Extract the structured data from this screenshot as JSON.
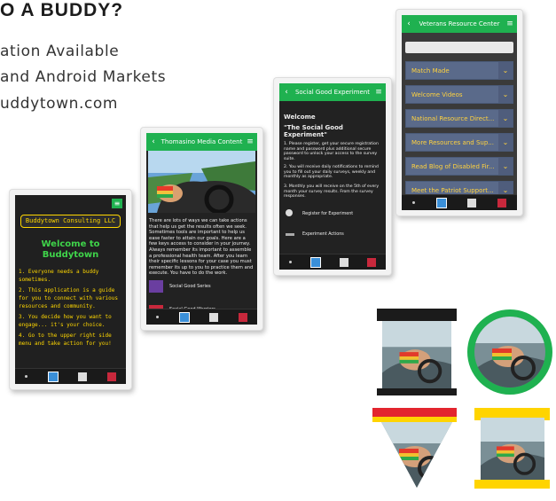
{
  "header": {
    "headline": "O A BUDDY?",
    "lines": [
      "ation Available",
      "and Android Markets",
      "uddytown.com"
    ]
  },
  "phone1": {
    "logo": "Buddytown Consulting LLC",
    "welcome": "Welcome to Buddytown",
    "items": [
      "1. Everyone needs a buddy sometimes.",
      "2. This application is a guide for you to connect with various resources and community.",
      "3. You decide how you want to engage... it's your choice.",
      "4. Go to the upper right side menu and take action for you!"
    ]
  },
  "phone2": {
    "title": "Thomasino Media Content",
    "body": "There are lots of ways we can take actions that help us get the results often we seek. Sometimes tools are important to help us ease faster to attain our goals. Here are a few keys access to consider in your journey. Always remember its important to assemble a professional health team. After you learn their specific lessons for your case you must remember its up to you to practice them and execute. You have to do the work.",
    "list": [
      "Social Good Series",
      "Social Good Warriors"
    ]
  },
  "phone3": {
    "title": "Social Good Experiment",
    "heading": "Welcome",
    "subheading": "\"The Social Good Experiment\"",
    "p1": "1. Please register, get your secure registration name and password plus additional secure password to unlock your access to the survey suite.",
    "p2": "2. You will receive daily notifications to remind you to fill out your daily surveys, weekly and monthly as appropriate.",
    "p3": "3. Monthly you will receive on the 5th of every month your survey results. From the survey responses.",
    "actions": [
      "Register for Experiment",
      "Experiment Actions"
    ]
  },
  "phone4": {
    "title": "Veterans Resource Center",
    "items": [
      "Match Made",
      "Welcome Videos",
      "National Resource Direct...",
      "More Resources and Sup...",
      "Read Blog of Disabled Fir...",
      "Meet the Patriot Support..."
    ]
  },
  "colors": {
    "app_green": "#1fb150",
    "yellow_text": "#ffd700",
    "welcome_green": "#3fd44a",
    "list_blue": "#5a6a8a"
  }
}
